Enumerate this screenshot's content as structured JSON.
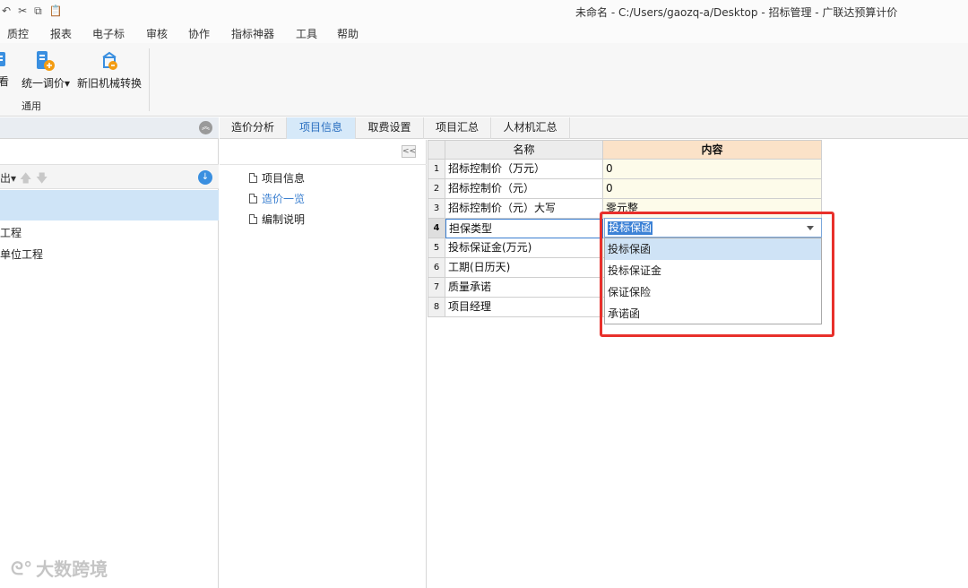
{
  "titlebar": {
    "quick_access": [
      "↶",
      "✂",
      "⧉",
      "📋"
    ],
    "title": "未命名 - C:/Users/gaozq-a/Desktop - 招标管理 - 广联达预算计价"
  },
  "menu": [
    "质控",
    "报表",
    "电子标",
    "审核",
    "协作",
    "指标神器",
    "工具",
    "帮助"
  ],
  "ribbon": {
    "btn_view_fragment": "看",
    "btn_unify_price": "统一调价",
    "btn_unify_price_caret": "▾",
    "btn_machine_convert": "新旧机械转换",
    "group_label": "通用"
  },
  "left_panel": {
    "toolbar_fragment": "出▾",
    "tree_items": [
      "工程",
      "单位工程"
    ]
  },
  "tabs": [
    "造价分析",
    "项目信息",
    "取费设置",
    "项目汇总",
    "人材机汇总"
  ],
  "active_tab": "项目信息",
  "nav": {
    "collapse": "<<",
    "items": [
      "项目信息",
      "造价一览",
      "编制说明"
    ],
    "active_item": "造价一览"
  },
  "grid": {
    "headers": {
      "name": "名称",
      "value": "内容"
    },
    "rows": [
      {
        "idx": "1",
        "name": "招标控制价（万元）",
        "value": "0"
      },
      {
        "idx": "2",
        "name": "招标控制价（元）",
        "value": "0"
      },
      {
        "idx": "3",
        "name": "招标控制价（元）大写",
        "value": "零元整"
      },
      {
        "idx": "4",
        "name": "担保类型",
        "value": ""
      },
      {
        "idx": "5",
        "name": "投标保证金(万元)",
        "value": ""
      },
      {
        "idx": "6",
        "name": "工期(日历天)",
        "value": ""
      },
      {
        "idx": "7",
        "name": "质量承诺",
        "value": ""
      },
      {
        "idx": "8",
        "name": "项目经理",
        "value": ""
      }
    ],
    "active_row": "4"
  },
  "dropdown": {
    "selected": "投标保函",
    "options": [
      "投标保函",
      "投标保证金",
      "保证保险",
      "承诺函"
    ],
    "highlighted": "投标保函"
  },
  "watermark": {
    "text": "大数跨境",
    "logo": "ᘓ°"
  },
  "colors": {
    "accent": "#3d82d6",
    "highlight_box": "#e8302b",
    "value_column": "#fdfbea",
    "header_value": "#fbe2c8"
  }
}
